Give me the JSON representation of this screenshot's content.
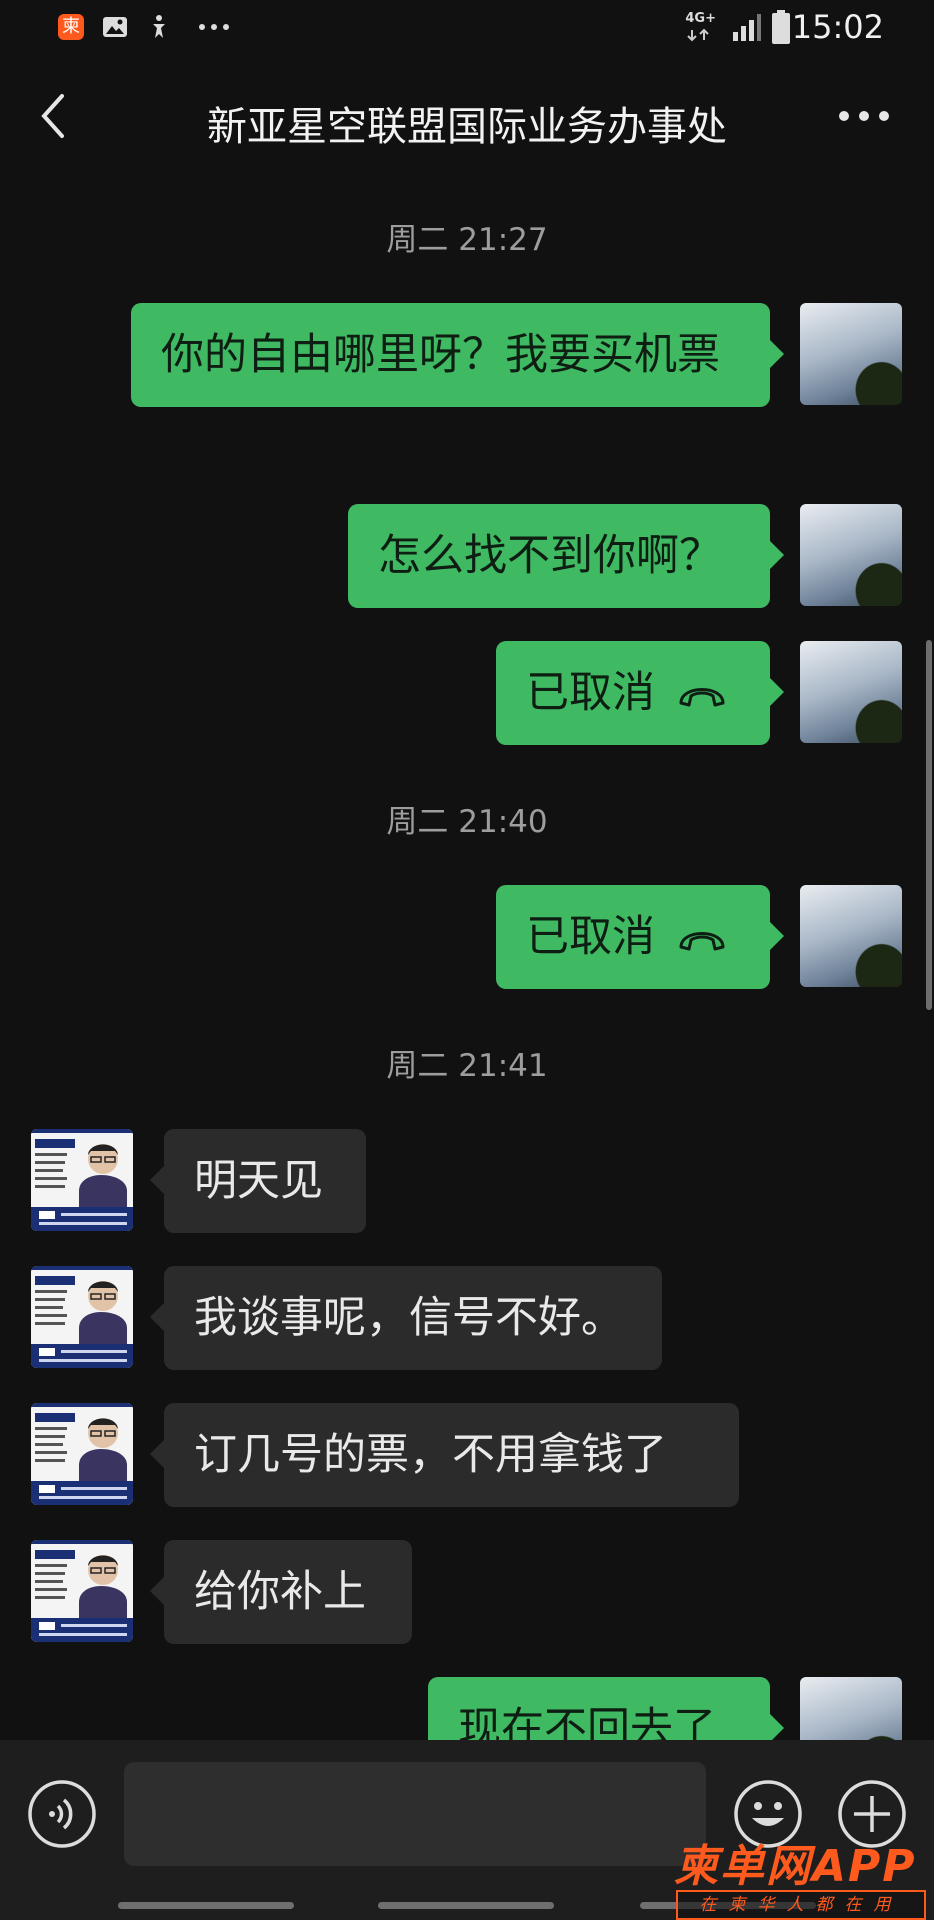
{
  "status_bar": {
    "time": "15:02",
    "network": "4G+",
    "icons": [
      "app-notification-icon",
      "image-notification-icon",
      "accessibility-icon",
      "more-notifications-icon",
      "signal-icon",
      "battery-icon"
    ]
  },
  "header": {
    "title": "新亚星空联盟国际业务办事处",
    "back_icon": "chevron-left-icon",
    "more_icon": "more-dots-icon"
  },
  "chat": {
    "timestamps": [
      "周二 21:27",
      "周二 21:40",
      "周二 21:41"
    ],
    "outgoing": [
      "你的自由哪里呀？我要买机票",
      "怎么找不到你啊？",
      "已取消",
      "已取消",
      "现在不回去了"
    ],
    "incoming": [
      "明天见",
      "我谈事呢，信号不好。",
      "订几号的票，不用拿钱了",
      "给你补上"
    ]
  },
  "toolbar": {
    "voice_icon": "voice-icon",
    "emoji_icon": "emoji-icon",
    "add_icon": "plus-icon"
  },
  "watermark": {
    "logo": "柬单网APP",
    "tagline": "在柬华人都在用"
  },
  "colors": {
    "background": "#111111",
    "outgoing_bubble": "#3fba63",
    "incoming_bubble": "#2b2b2b",
    "watermark": "#ff5a1e"
  }
}
